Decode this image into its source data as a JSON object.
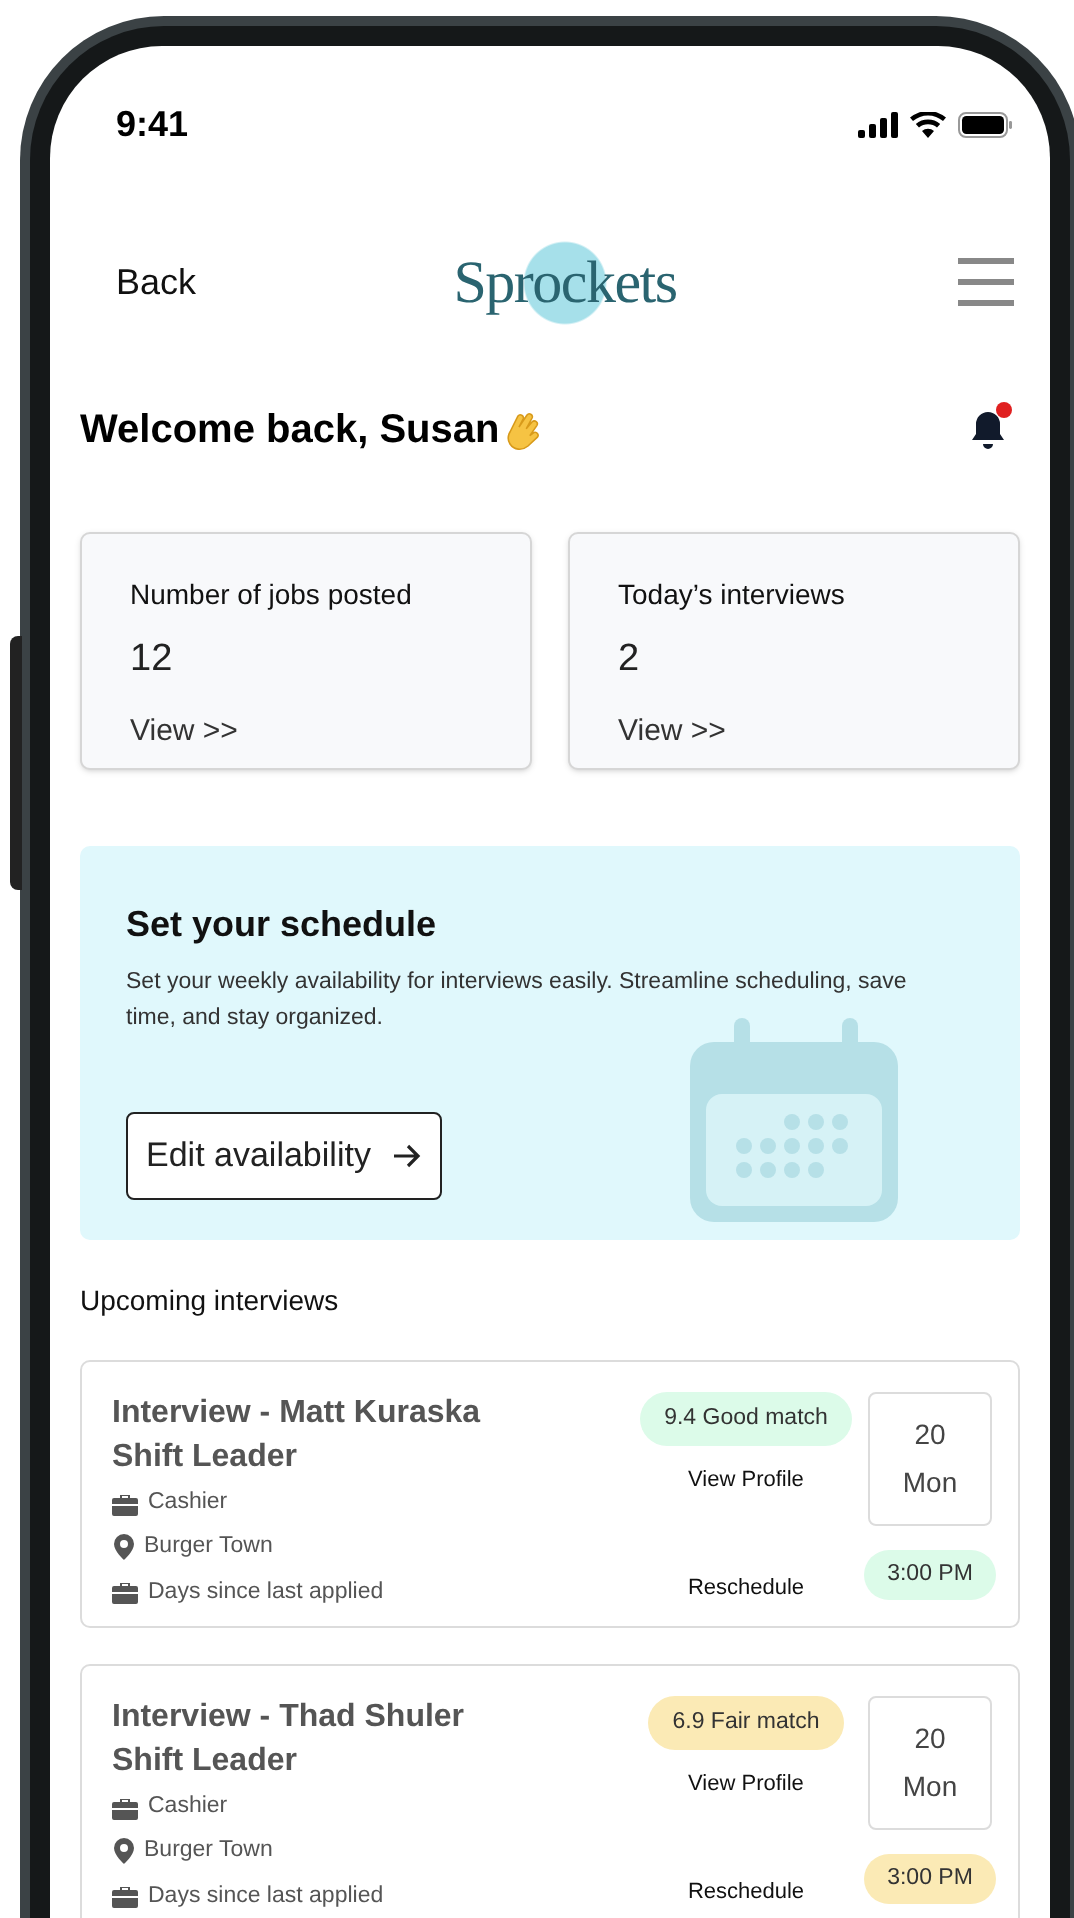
{
  "status_bar": {
    "time": "9:41"
  },
  "header": {
    "back": "Back",
    "logo": "Sprockets"
  },
  "welcome": {
    "title": "Welcome back, Susan",
    "notification": true
  },
  "stats": [
    {
      "label": "Number of jobs posted",
      "value": "12",
      "link": "View >>"
    },
    {
      "label": "Today’s interviews",
      "value": "2",
      "link": "View >>"
    }
  ],
  "schedule": {
    "title": "Set your schedule",
    "text": "Set your weekly availability for interviews easily. Streamline scheduling, save time, and stay organized.",
    "button": "Edit availability"
  },
  "upcoming": {
    "title": "Upcoming interviews",
    "items": [
      {
        "title": "Interview - Matt Kuraska",
        "role": "Shift Leader",
        "job": "Cashier",
        "location": "Burger Town",
        "note": "Days since last applied",
        "match": "9.4 Good match",
        "color": "#dcfbe9",
        "view": "View Profile",
        "reschedule": "Reschedule",
        "day": "20",
        "weekday": "Mon",
        "time": "3:00 PM"
      },
      {
        "title": "Interview - Thad Shuler",
        "role": "Shift Leader",
        "job": "Cashier",
        "location": "Burger Town",
        "note": "Days since last applied",
        "match": "6.9 Fair match",
        "color": "#fbeab5",
        "view": "View Profile",
        "reschedule": "Reschedule",
        "day": "20",
        "weekday": "Mon",
        "time": "3:00 PM"
      }
    ]
  }
}
